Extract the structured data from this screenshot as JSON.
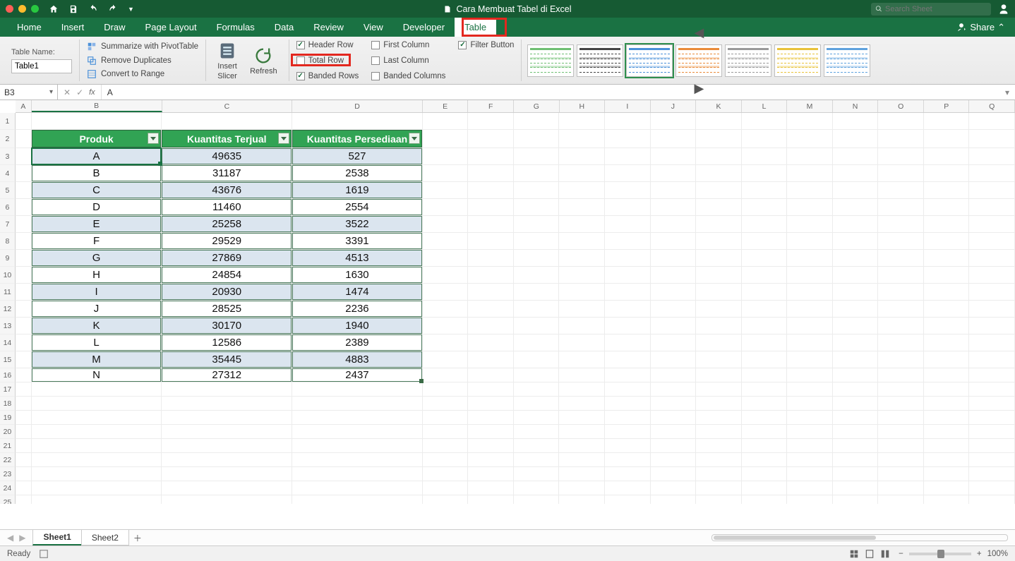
{
  "title": "Cara Membuat Tabel di Excel",
  "search_placeholder": "Search Sheet",
  "share_label": "Share",
  "ribbon_tabs": [
    "Home",
    "Insert",
    "Draw",
    "Page Layout",
    "Formulas",
    "Data",
    "Review",
    "View",
    "Developer",
    "Table"
  ],
  "active_tab": "Table",
  "table_name_label": "Table Name:",
  "table_name_value": "Table1",
  "tools": {
    "pivot": "Summarize with PivotTable",
    "dup": "Remove Duplicates",
    "range": "Convert to Range",
    "slicer_top": "Insert",
    "slicer_bottom": "Slicer",
    "refresh": "Refresh"
  },
  "checks": {
    "header_row": "Header Row",
    "total_row": "Total Row",
    "banded_rows": "Banded Rows",
    "first_col": "First Column",
    "last_col": "Last Column",
    "banded_cols": "Banded Columns",
    "filter_btn": "Filter Button"
  },
  "namebox": "B3",
  "formula_value": "A",
  "columns": [
    "A",
    "B",
    "C",
    "D",
    "E",
    "F",
    "G",
    "H",
    "I",
    "J",
    "K",
    "L",
    "M",
    "N",
    "O",
    "P",
    "Q"
  ],
  "table": {
    "headers": [
      "Produk",
      "Kuantitas Terjual",
      "Kuantitas Persediaan"
    ],
    "rows": [
      [
        "A",
        "49635",
        "527"
      ],
      [
        "B",
        "31187",
        "2538"
      ],
      [
        "C",
        "43676",
        "1619"
      ],
      [
        "D",
        "11460",
        "2554"
      ],
      [
        "E",
        "25258",
        "3522"
      ],
      [
        "F",
        "29529",
        "3391"
      ],
      [
        "G",
        "27869",
        "4513"
      ],
      [
        "H",
        "24854",
        "1630"
      ],
      [
        "I",
        "20930",
        "1474"
      ],
      [
        "J",
        "28525",
        "2236"
      ],
      [
        "K",
        "30170",
        "1940"
      ],
      [
        "L",
        "12586",
        "2389"
      ],
      [
        "M",
        "35445",
        "4883"
      ],
      [
        "N",
        "27312",
        "2437"
      ]
    ]
  },
  "sheets": [
    "Sheet1",
    "Sheet2"
  ],
  "active_sheet": "Sheet1",
  "status": "Ready",
  "zoom_label": "100%",
  "style_colors": [
    "#6fbf73",
    "#444444",
    "#4a90d9",
    "#e98b3a",
    "#999999",
    "#e8c23a",
    "#5fa2dd"
  ]
}
